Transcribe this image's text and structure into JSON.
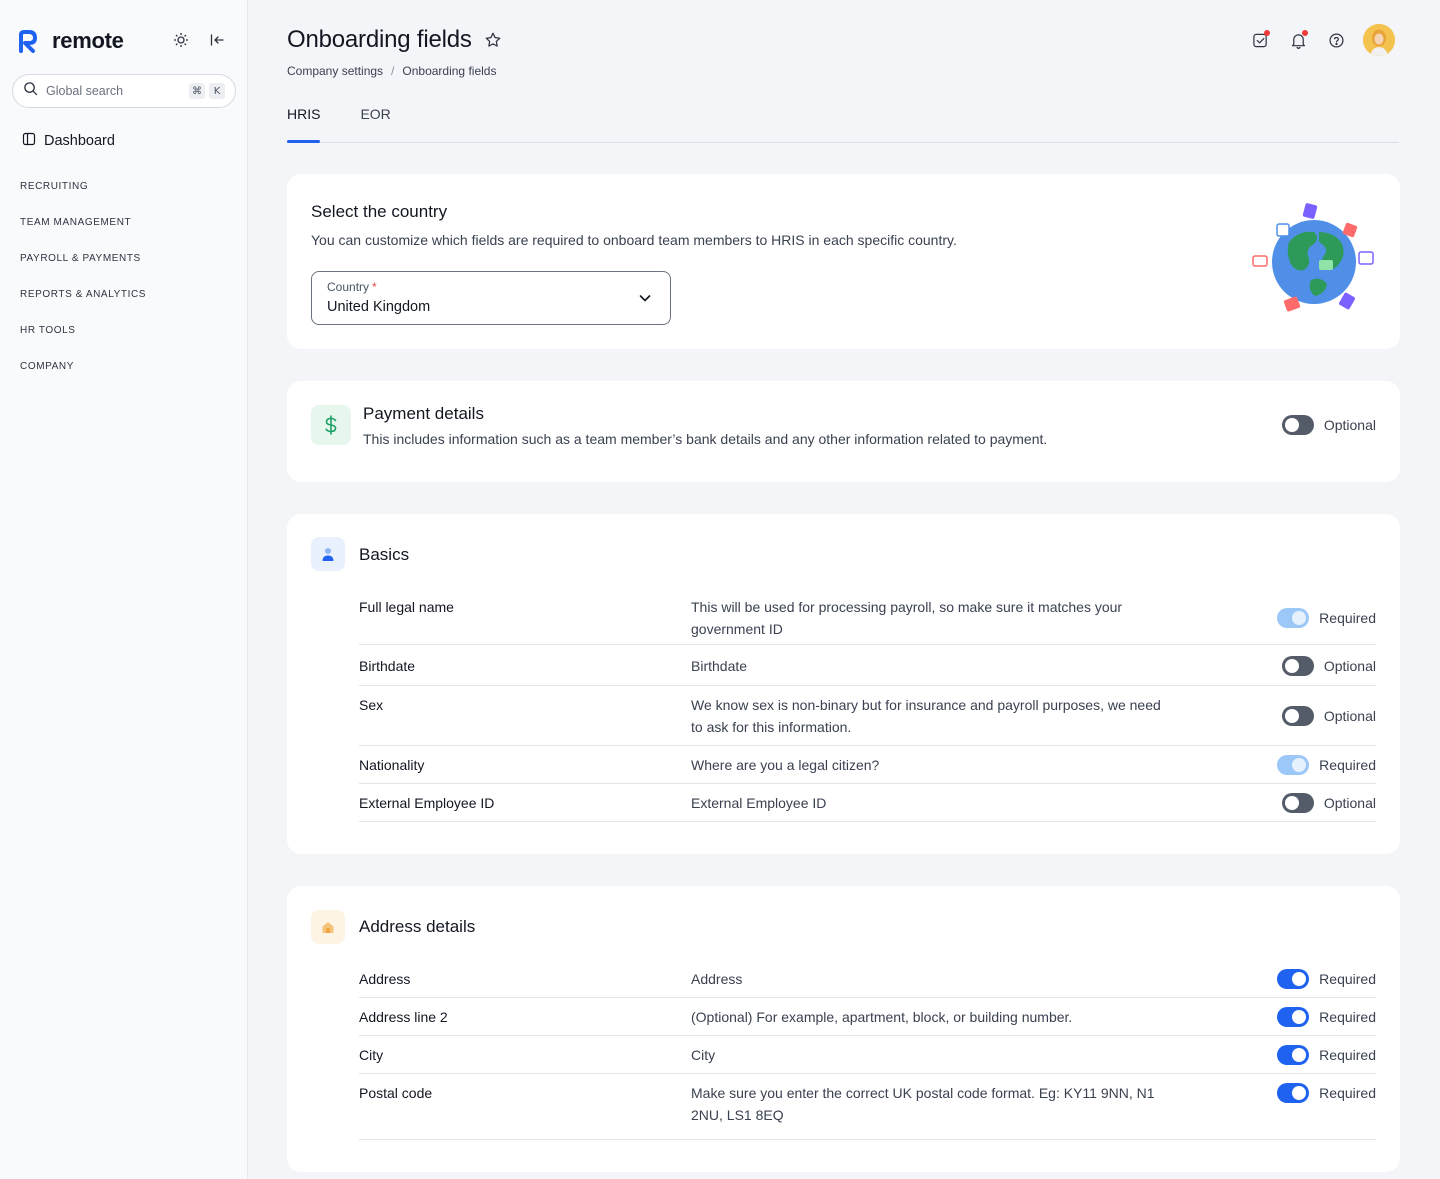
{
  "brand": {
    "name": "remote"
  },
  "sidebar": {
    "search_placeholder": "Global search",
    "shortcut_keys": [
      "⌘",
      "K"
    ],
    "dashboard_label": "Dashboard",
    "sections": [
      "RECRUITING",
      "TEAM MANAGEMENT",
      "PAYROLL & PAYMENTS",
      "REPORTS & ANALYTICS",
      "HR TOOLS",
      "COMPANY"
    ]
  },
  "header": {
    "title": "Onboarding fields",
    "breadcrumb": [
      "Company settings",
      "Onboarding fields"
    ],
    "breadcrumb_separator": "/"
  },
  "tabs": [
    {
      "label": "HRIS",
      "active": true
    },
    {
      "label": "EOR",
      "active": false
    }
  ],
  "country_card": {
    "title": "Select the country",
    "description": "You can customize which fields are required to onboard team members to HRIS in each specific country.",
    "select_label": "Country",
    "required_mark": "*",
    "selected_value": "United Kingdom"
  },
  "payment_card": {
    "title": "Payment details",
    "description": "This includes information such as a team member’s bank details and any other information related to payment.",
    "toggle_state": "off",
    "toggle_label": "Optional"
  },
  "basics_card": {
    "title": "Basics",
    "fields": [
      {
        "name": "Full legal name",
        "description": "This will be used for processing payroll, so make sure it matches your government ID",
        "state": "disabled",
        "label": "Required"
      },
      {
        "name": "Birthdate",
        "description": "Birthdate",
        "state": "off",
        "label": "Optional"
      },
      {
        "name": "Sex",
        "description": "We know sex is non-binary but for insurance and payroll purposes, we need to ask for this information.",
        "state": "off",
        "label": "Optional"
      },
      {
        "name": "Nationality",
        "description": "Where are you a legal citizen?",
        "state": "disabled",
        "label": "Required"
      },
      {
        "name": "External Employee ID",
        "description": "External Employee ID",
        "state": "off",
        "label": "Optional"
      }
    ]
  },
  "address_card": {
    "title": "Address details",
    "fields": [
      {
        "name": "Address",
        "description": "Address",
        "state": "on",
        "label": "Required"
      },
      {
        "name": "Address line 2",
        "description": "(Optional) For example, apartment, block, or building number.",
        "state": "on",
        "label": "Required"
      },
      {
        "name": "City",
        "description": "City",
        "state": "on",
        "label": "Required"
      },
      {
        "name": "Postal code",
        "description": "Make sure you enter the correct UK postal code format. Eg: KY11 9NN, N1 2NU, LS1 8EQ",
        "state": "on",
        "label": "Required"
      }
    ]
  },
  "colors": {
    "accent": "#1f62f0",
    "toggle_off": "#555c69",
    "toggle_disabled": "#9cc8f8",
    "payment_icon": "#1aa163",
    "basics_icon": "#1f62f0",
    "address_icon": "#f2a640"
  },
  "icons": {
    "theme": "sun-icon",
    "collapse": "collapse-sidebar-icon",
    "search": "search-icon",
    "dashboard": "sidebar-panel-icon",
    "favorite": "star-icon",
    "tasks": "tasks-icon",
    "notifications": "bell-icon",
    "help": "help-icon",
    "payment": "dollar-icon",
    "basics": "user-icon",
    "address": "house-icon"
  }
}
